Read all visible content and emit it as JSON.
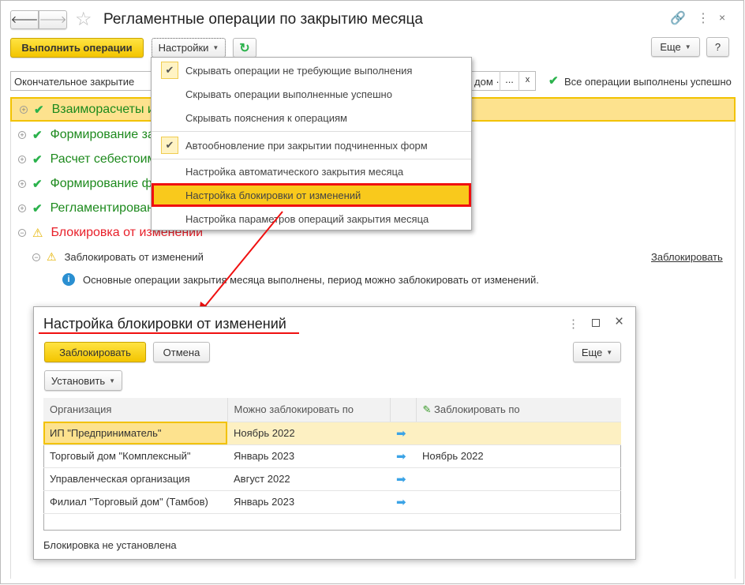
{
  "window": {
    "title": "Регламентные операции по закрытию месяца"
  },
  "toolbar": {
    "run": "Выполнить операции",
    "settings": "Настройки",
    "more": "Еще",
    "help": "?"
  },
  "filter": {
    "value": "Окончательное закрытие",
    "org_tail": "дом ·",
    "select": "...",
    "clear": "x",
    "status": "Все операции выполнены успешно"
  },
  "tree": [
    {
      "label": "Взаимор асчеты и",
      "status": "ok"
    },
    {
      "label": "Формирование за",
      "status": "ok"
    },
    {
      "label": "Расчет себестоим",
      "status": "ok"
    },
    {
      "label": "Формирование ф",
      "status": "ok"
    },
    {
      "label": "Регламентирован",
      "status": "ok"
    },
    {
      "label": "Блокировка от изменений",
      "status": "warning"
    }
  ],
  "subitem": {
    "label": "Заблокировать от изменений",
    "link": "Заблокировать",
    "info": "Основные операции закрытия месяца выполнены, период можно заблокировать от изменений."
  },
  "menu": {
    "items": [
      {
        "label": "Скрывать операции не требующие выполнения",
        "checked": true
      },
      {
        "label": "Скрывать операции выполненные успешно",
        "checked": false
      },
      {
        "label": "Скрывать пояснения к операциям",
        "checked": false
      },
      {
        "label": "Автообновление при закрытии подчиненных форм",
        "checked": true
      },
      {
        "label": "Настройка автоматического закрытия месяца"
      },
      {
        "label": "Настройка блокировки от изменений",
        "highlighted": true
      },
      {
        "label": "Настройка параметров операций закрытия месяца"
      }
    ]
  },
  "dialog": {
    "title": "Настройка блокировки от изменений",
    "lock": "Заблокировать",
    "cancel": "Отмена",
    "more": "Еще",
    "set": "Установить",
    "columns": [
      "Организация",
      "Можно заблокировать по",
      "",
      "Заблокировать по"
    ],
    "rows": [
      [
        "ИП \"Предприниматель\"",
        "Ноябрь 2022",
        ""
      ],
      [
        "Торговый дом \"Комплексный\"",
        "Январь 2023",
        "Ноябрь 2022"
      ],
      [
        "Управленческая организация",
        "Август 2022",
        ""
      ],
      [
        "Филиал \"Торговый дом\" (Тамбов)",
        "Январь 2023",
        ""
      ]
    ],
    "status": "Блокировка не установлена"
  },
  "colors": {
    "accent": "#f3c500",
    "ok": "#2bb24c",
    "warning_text": "#e8202a",
    "highlight_frame": "#ff0000"
  }
}
